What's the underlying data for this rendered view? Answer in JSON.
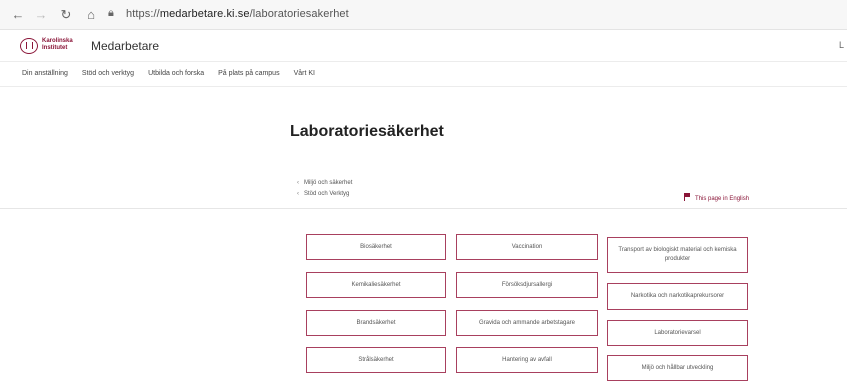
{
  "browser": {
    "url_prefix": "https://",
    "url_domain": "medarbetare.ki.se",
    "url_path": "/laboratoriesakerhet"
  },
  "header": {
    "logo_text": "Karolinska Institutet",
    "site_name": "Medarbetare"
  },
  "nav": {
    "items": [
      "Din anställning",
      "Stöd och verktyg",
      "Utbilda och forska",
      "På plats på campus",
      "Vårt KI"
    ]
  },
  "page": {
    "title": "Laboratoriesäkerhet"
  },
  "breadcrumb": {
    "items": [
      "Miljö och säkerhet",
      "Stöd och Verktyg"
    ]
  },
  "english_link": "This page in English",
  "cards": {
    "col1": [
      "Biosäkerhet",
      "Kemikaliesäkerhet",
      "Brandsäkerhet",
      "Strålsäkerhet"
    ],
    "col2": [
      "Vaccination",
      "Försöksdjursallergi",
      "Gravida och ammande arbetstagare",
      "Hantering av avfall"
    ],
    "col3": [
      "Transport av biologiskt material och kemiska produkter",
      "Narkotika och narkotikaprekursorer",
      "Laboratorievarsel",
      "Miljö och hållbar utveckling"
    ]
  },
  "colors": {
    "accent": "#8a1538",
    "card_border": "#a8405e"
  }
}
